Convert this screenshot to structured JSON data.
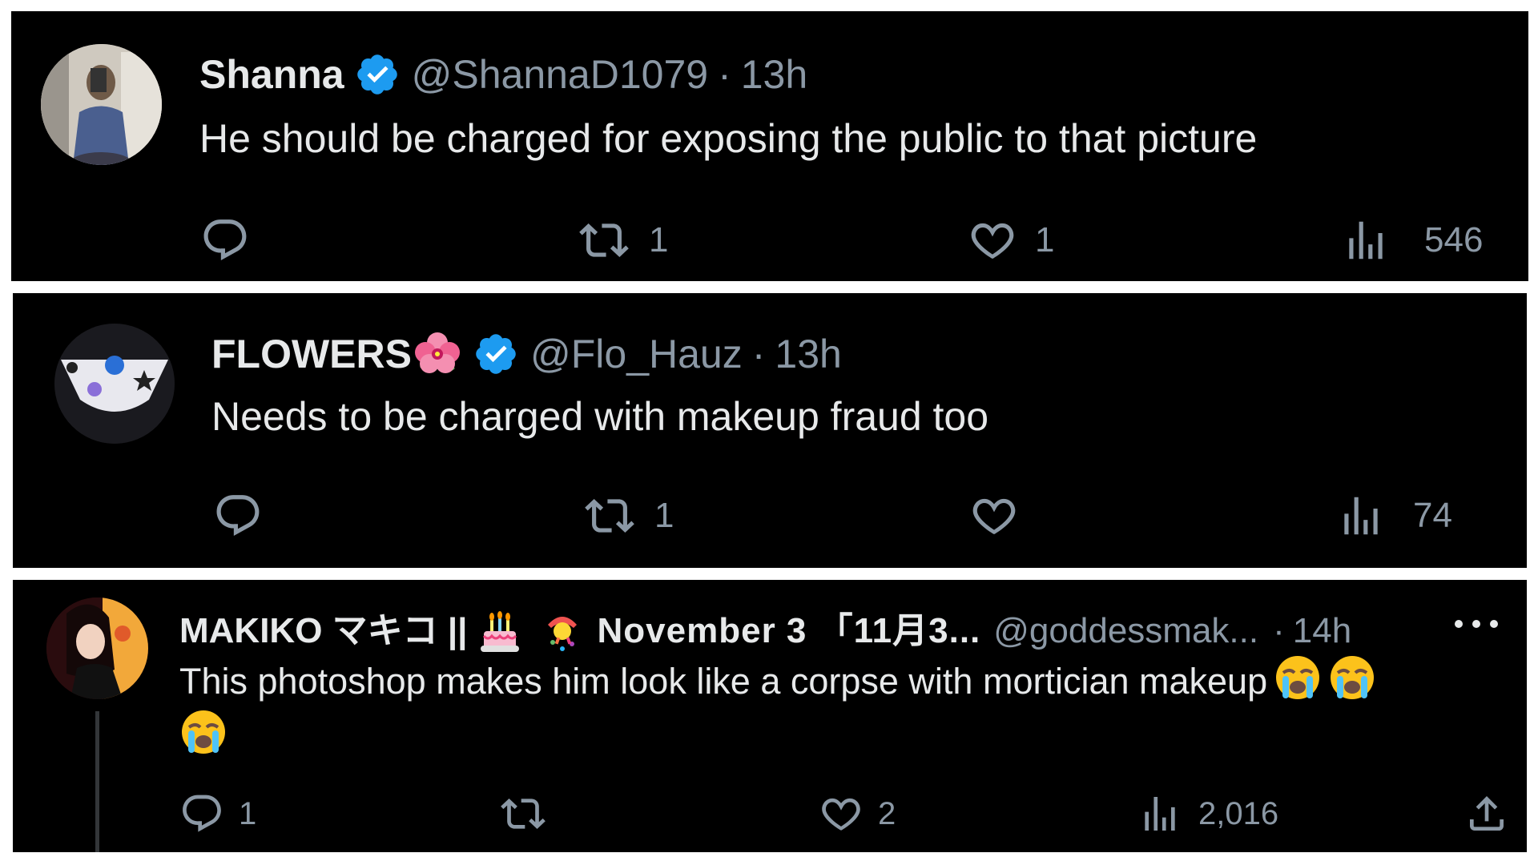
{
  "posts": [
    {
      "name": "Shanna",
      "handle": "@ShannaD1079",
      "sep": "·",
      "time": "13h",
      "text": "He should be charged for exposing the public to that picture",
      "actions": {
        "replies": "",
        "reposts": "1",
        "likes": "1",
        "views": "546"
      }
    },
    {
      "name": "FLOWERS",
      "handle": "@Flo_Hauz",
      "sep": "·",
      "time": "13h",
      "text": "Needs to be charged with makeup fraud too",
      "actions": {
        "replies": "",
        "reposts": "1",
        "likes": "",
        "views": "74"
      }
    },
    {
      "name_part1": "MAKIKO マキコ ||",
      "name_part2": "November 3 「11月3...",
      "handle": "@goddessmak...",
      "sep": "·",
      "time": "14h",
      "text": "This photoshop makes him look like a corpse with mortician makeup",
      "actions": {
        "replies": "1",
        "reposts": "",
        "likes": "2",
        "views": "2,016"
      }
    }
  ],
  "colors": {
    "background": "#000000",
    "verified": "#1d9bf0",
    "muted": "#8b98a5",
    "text": "#e7e9ea"
  },
  "icons": [
    "reply-icon",
    "repost-icon",
    "like-icon",
    "views-icon",
    "share-icon",
    "more-icon",
    "verified-badge-icon",
    "hibiscus-emoji",
    "birthday-cake-emoji",
    "confetti-emoji",
    "loudly-crying-emoji"
  ]
}
